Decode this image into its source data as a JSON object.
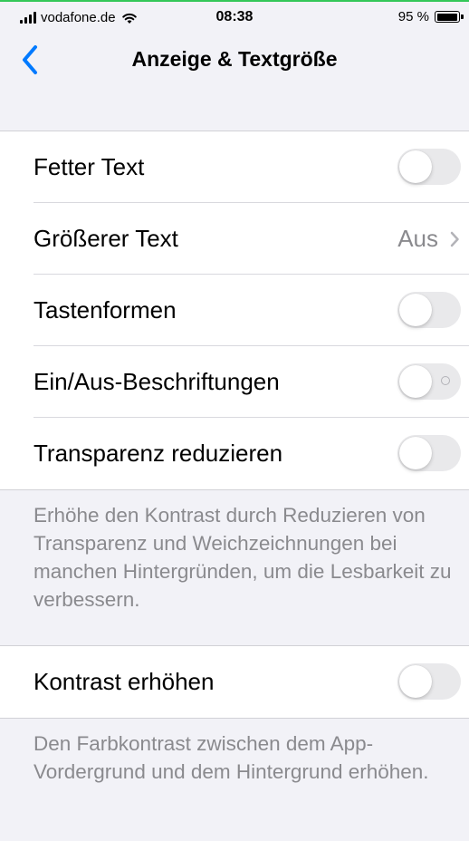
{
  "status_bar": {
    "carrier": "vodafone.de",
    "time": "08:38",
    "battery": "95 %"
  },
  "nav": {
    "title": "Anzeige & Textgröße",
    "back_icon": "chevron-left-icon"
  },
  "section1": {
    "rows": [
      {
        "label": "Fetter Text",
        "type": "toggle",
        "on": false
      },
      {
        "label": "Größerer Text",
        "type": "disclosure",
        "value": "Aus"
      },
      {
        "label": "Tastenformen",
        "type": "toggle",
        "on": false
      },
      {
        "label": "Ein/Aus-Beschriftungen",
        "type": "toggle",
        "on": false
      },
      {
        "label": "Transparenz reduzieren",
        "type": "toggle",
        "on": false
      }
    ],
    "footer": "Erhöhe den Kontrast durch Reduzieren von Transparenz und Weichzeichnungen bei manchen Hintergründen, um die Lesbarkeit zu verbessern."
  },
  "section2": {
    "rows": [
      {
        "label": "Kontrast erhöhen",
        "type": "toggle",
        "on": false
      }
    ],
    "footer": "Den Farbkontrast zwischen dem App-Vordergrund und dem Hintergrund erhöhen."
  },
  "colors": {
    "accent": "#007aff",
    "background": "#f2f2f7",
    "toggle_off": "#e9e9eb",
    "secondary_text": "#8a8a8e"
  }
}
